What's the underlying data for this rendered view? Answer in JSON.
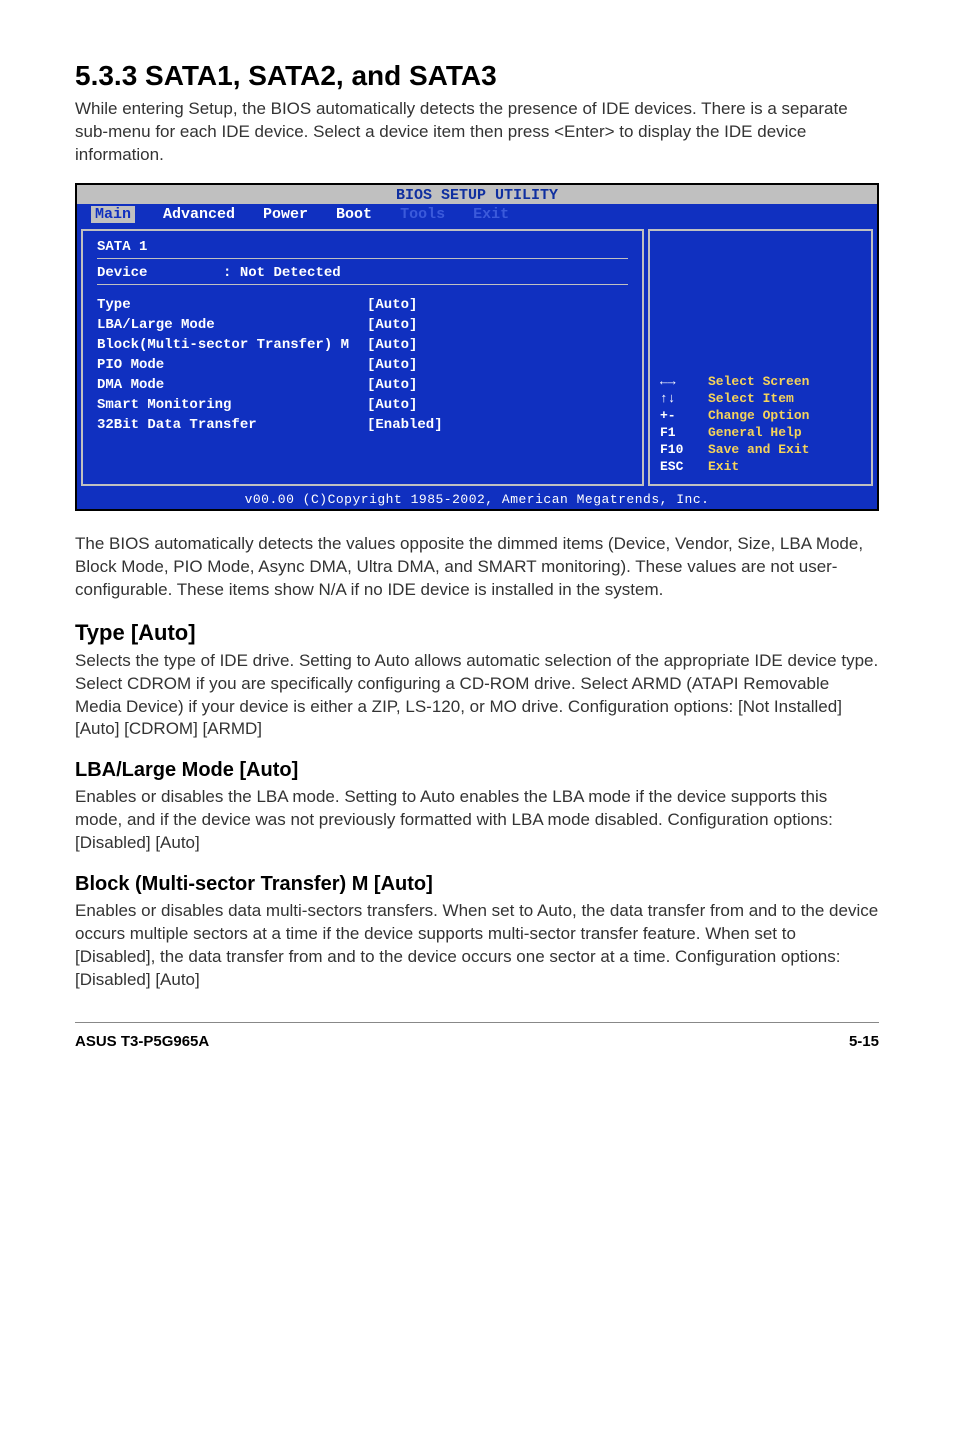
{
  "section": {
    "number_title": "5.3.3   SATA1, SATA2, and SATA3",
    "intro": "While entering Setup, the BIOS automatically detects the presence of IDE devices. There is a separate sub-menu for each IDE device. Select a device item then press <Enter> to display the IDE device information."
  },
  "bios": {
    "title": "BIOS SETUP UTILITY",
    "menu": {
      "main": "Main",
      "advanced": "Advanced",
      "power": "Power",
      "boot": "Boot",
      "tools": "Tools",
      "exit": "Exit"
    },
    "sata_header": "SATA 1",
    "device_label": "Device",
    "device_value": ": Not Detected",
    "options": [
      {
        "label": "Type",
        "value": "[Auto]"
      },
      {
        "label": "LBA/Large Mode",
        "value": "[Auto]"
      },
      {
        "label": "Block(Multi-sector Transfer) M",
        "value": "[Auto]"
      },
      {
        "label": "PIO Mode",
        "value": "[Auto]"
      },
      {
        "label": "DMA Mode",
        "value": "[Auto]"
      },
      {
        "label": "Smart Monitoring",
        "value": "[Auto]"
      },
      {
        "label": "32Bit Data Transfer",
        "value": "[Enabled]"
      }
    ],
    "help": [
      {
        "key": "←→",
        "desc": "Select Screen"
      },
      {
        "key": "↑↓",
        "desc": "Select Item"
      },
      {
        "key": "+-",
        "desc": "Change Option"
      },
      {
        "key": "F1",
        "desc": "General Help"
      },
      {
        "key": "F10",
        "desc": "Save and Exit"
      },
      {
        "key": "ESC",
        "desc": "Exit"
      }
    ],
    "footer": "v00.00 (C)Copyright 1985-2002, American Megatrends, Inc."
  },
  "body": {
    "auto_detect": "The BIOS automatically detects the values opposite the dimmed items (Device, Vendor, Size, LBA Mode, Block Mode, PIO Mode, Async DMA, Ultra DMA, and SMART monitoring). These values are not user-configurable. These items show N/A if no IDE device is installed in the system.",
    "type_heading": "Type [Auto]",
    "type_text": "Selects the type of IDE drive. Setting to Auto allows automatic selection of the appropriate IDE device type. Select CDROM if you are specifically configuring a CD-ROM drive. Select ARMD (ATAPI Removable Media Device) if your device is either a ZIP, LS-120, or MO drive. Configuration options: [Not Installed] [Auto] [CDROM] [ARMD]",
    "lba_heading": "LBA/Large Mode [Auto]",
    "lba_text": "Enables or disables the LBA mode. Setting to Auto enables the LBA mode if the device supports this mode, and if the device was not previously formatted with LBA mode disabled. Configuration options: [Disabled] [Auto]",
    "block_heading": "Block (Multi-sector Transfer) M [Auto]",
    "block_text": "Enables or disables data multi-sectors transfers. When set to Auto, the data transfer from and to the device occurs multiple sectors at a time if the device supports multi-sector transfer feature. When set to [Disabled], the data transfer from and to the device occurs one sector at a time. Configuration options: [Disabled] [Auto]"
  },
  "footer": {
    "product": "ASUS T3-P5G965A",
    "page": "5-15"
  }
}
